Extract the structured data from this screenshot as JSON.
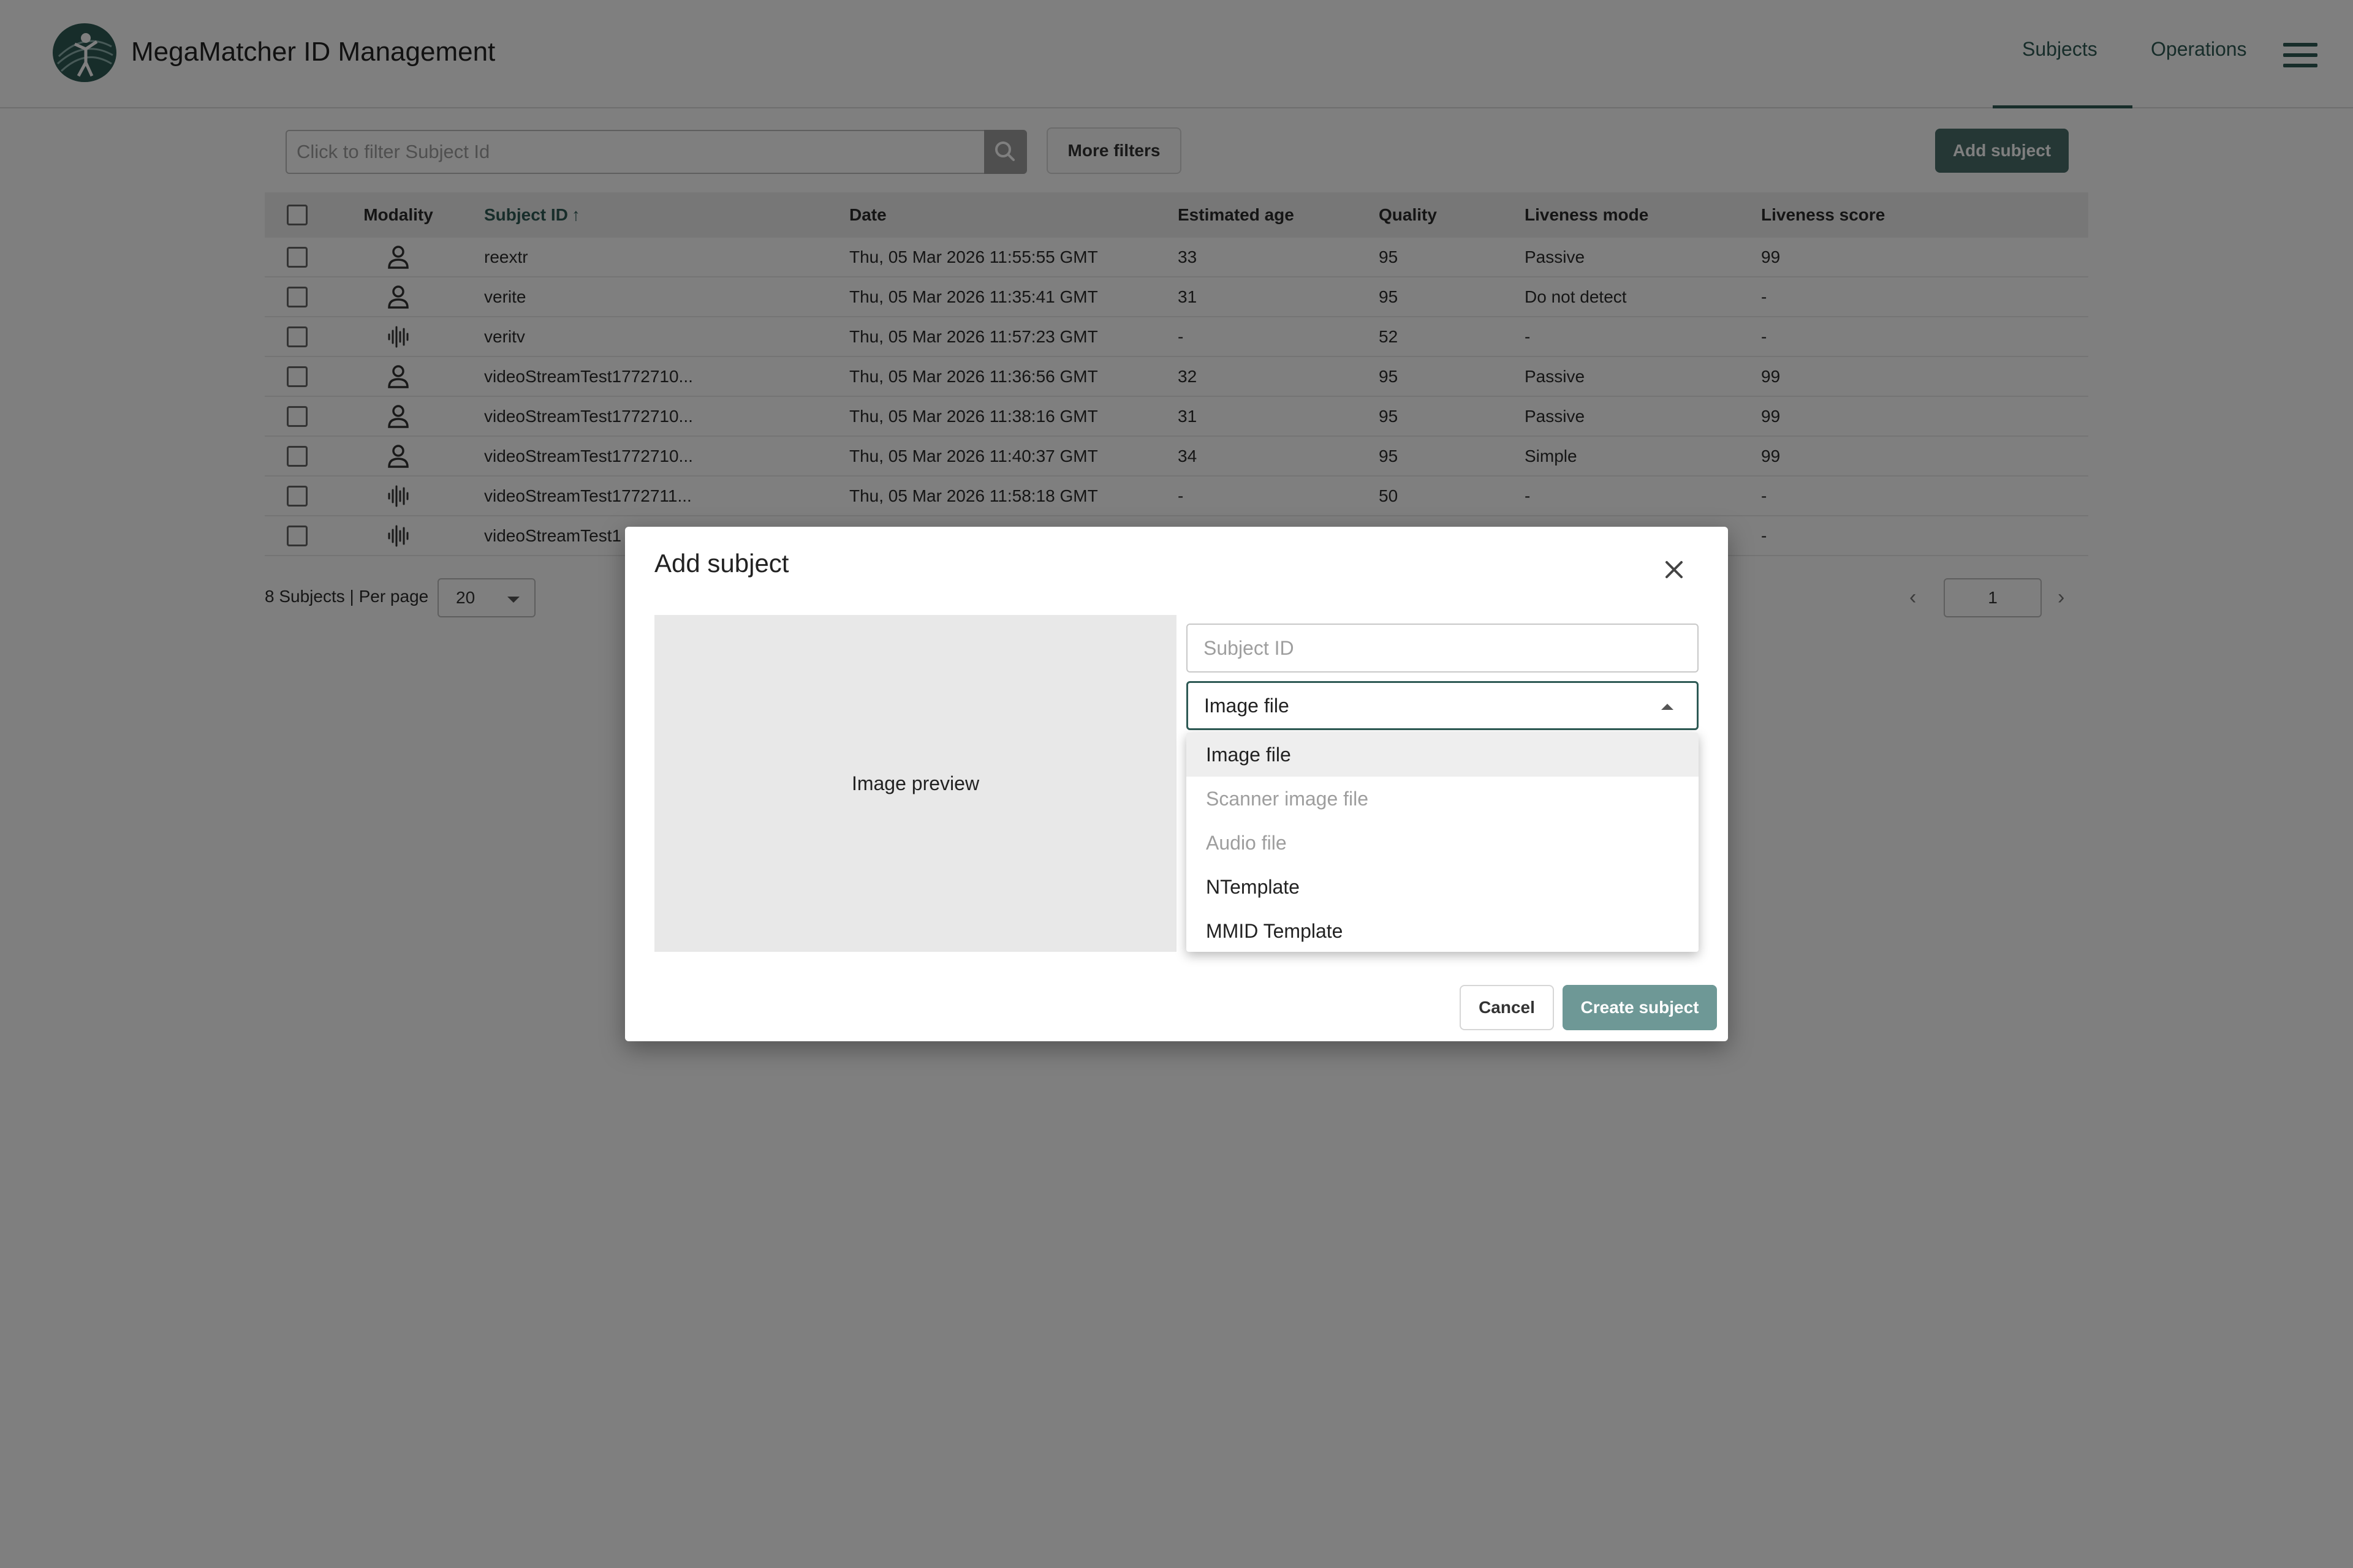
{
  "app": {
    "title": "MegaMatcher ID Management",
    "logo_icon": "fingerprint-person-logo-icon"
  },
  "nav": {
    "tabs": [
      {
        "label": "Subjects",
        "active": true
      },
      {
        "label": "Operations",
        "active": false
      }
    ],
    "menu_icon": "hamburger-menu-icon"
  },
  "filter": {
    "placeholder": "Click to filter Subject Id",
    "search_icon": "search-icon",
    "more_filters_label": "More filters",
    "add_subject_label": "Add subject"
  },
  "table": {
    "headers": {
      "modality": "Modality",
      "subject_id": "Subject ID",
      "sort_indicator": "↑",
      "date": "Date",
      "estimated_age": "Estimated age",
      "quality": "Quality",
      "liveness_mode": "Liveness mode",
      "liveness_score": "Liveness score"
    },
    "rows": [
      {
        "modality": "face",
        "subject_id": "reextr",
        "date": "Thu, 05 Mar 2026 11:55:55 GMT",
        "age": "33",
        "quality": "95",
        "liveness_mode": "Passive",
        "liveness_score": "99"
      },
      {
        "modality": "face",
        "subject_id": "verite",
        "date": "Thu, 05 Mar 2026 11:35:41 GMT",
        "age": "31",
        "quality": "95",
        "liveness_mode": "Do not detect",
        "liveness_score": "-"
      },
      {
        "modality": "voice",
        "subject_id": "veritv",
        "date": "Thu, 05 Mar 2026 11:57:23 GMT",
        "age": "-",
        "quality": "52",
        "liveness_mode": "-",
        "liveness_score": "-"
      },
      {
        "modality": "face",
        "subject_id": "videoStreamTest1772710...",
        "date": "Thu, 05 Mar 2026 11:36:56 GMT",
        "age": "32",
        "quality": "95",
        "liveness_mode": "Passive",
        "liveness_score": "99"
      },
      {
        "modality": "face",
        "subject_id": "videoStreamTest1772710...",
        "date": "Thu, 05 Mar 2026 11:38:16 GMT",
        "age": "31",
        "quality": "95",
        "liveness_mode": "Passive",
        "liveness_score": "99"
      },
      {
        "modality": "face",
        "subject_id": "videoStreamTest1772710...",
        "date": "Thu, 05 Mar 2026 11:40:37 GMT",
        "age": "34",
        "quality": "95",
        "liveness_mode": "Simple",
        "liveness_score": "99"
      },
      {
        "modality": "voice",
        "subject_id": "videoStreamTest1772711...",
        "date": "Thu, 05 Mar 2026 11:58:18 GMT",
        "age": "-",
        "quality": "50",
        "liveness_mode": "-",
        "liveness_score": "-"
      },
      {
        "modality": "voice",
        "subject_id": "videoStreamTest1",
        "date": "",
        "age": "",
        "quality": "",
        "liveness_mode": "",
        "liveness_score": "-"
      }
    ]
  },
  "pagination": {
    "summary": "8 Subjects | Per page",
    "per_page": "20",
    "current_page": "1"
  },
  "dialog": {
    "title": "Add subject",
    "close_icon": "close-icon",
    "preview_label": "Image preview",
    "subject_id_placeholder": "Subject ID",
    "type_selected": "Image file",
    "type_options": [
      {
        "label": "Image file",
        "disabled": false,
        "selected": true
      },
      {
        "label": "Scanner image file",
        "disabled": true,
        "selected": false
      },
      {
        "label": "Audio file",
        "disabled": true,
        "selected": false
      },
      {
        "label": "NTemplate",
        "disabled": false,
        "selected": false
      },
      {
        "label": "MMID Template",
        "disabled": false,
        "selected": false
      }
    ],
    "cancel_label": "Cancel",
    "create_label": "Create subject"
  },
  "colors": {
    "accent": "#2e5a55",
    "primary_button": "#4a6e6a",
    "create_button": "#6e9896",
    "overlay": "rgba(0,0,0,0.5)"
  }
}
